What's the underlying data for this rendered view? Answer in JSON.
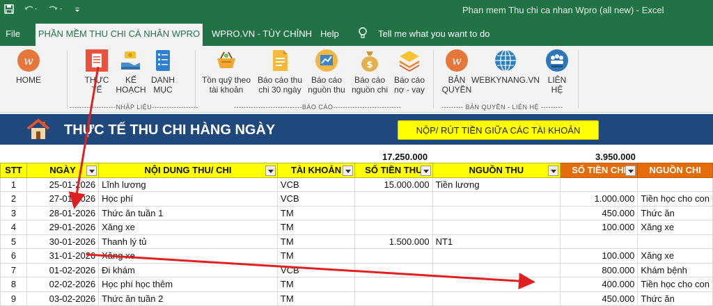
{
  "titlebar": {
    "title": "Phan mem Thu chi ca nhan Wpro (all new)  -  Excel"
  },
  "menu": {
    "file": "File",
    "active_tab": "PHẦN MỀM THU CHI CÁ NHÂN WPRO",
    "tab2": "WPRO.VN - TÙY CHỈNH",
    "help": "Help",
    "tell_me": "Tell me what you want to do"
  },
  "ribbon": {
    "home": "HOME",
    "thuc_te_1": "THỰC",
    "thuc_te_2": "TẾ",
    "ke_hoach_1": "KẾ",
    "ke_hoach_2": "HOẠCH",
    "danh_muc_1": "DANH",
    "danh_muc_2": "MỤC",
    "ton_quy_1": "Tồn quỹ theo",
    "ton_quy_2": "tài khoản",
    "bc30_1": "Báo cáo thu",
    "bc30_2": "chi 30 ngày",
    "bcnt_1": "Báo cáo",
    "bcnt_2": "nguồn thu",
    "bcnc_1": "Báo cáo",
    "bcnc_2": "nguồn chi",
    "bcno_1": "Báo cáo",
    "bcno_2": "nợ - vay",
    "ban_quyen_1": "BẢN",
    "ban_quyen_2": "QUYỀN",
    "webkynang": "WEBKYNANG.VN",
    "lien_he_1": "LIÊN",
    "lien_he_2": "HỆ",
    "group_nhap_lieu": "-------------------NHẬP LIỆU-------------------",
    "group_bao_cao": "----------------------------BÁO CÁO----------------------------",
    "group_ban_quyen": "--------- BẢN QUYỀN - LIÊN HỆ ---------"
  },
  "sheet": {
    "title": "THỰC TẾ THU CHI HÀNG NGÀY",
    "transfer_button": "NỘP/ RÚT TIỀN GIỮA CÁC TÀI KHOẢN",
    "total_thu": "17.250.000",
    "total_chi": "3.950.000",
    "headers": [
      "STT",
      "NGÀY",
      "NỘI DUNG THU/ CHI",
      "TÀI KHOẢN",
      "SỐ TIỀN THU",
      "NGUỒN THU",
      "SỐ TIỀN CHI",
      "NGUỒN CHI"
    ],
    "rows": [
      {
        "stt": "1",
        "date": "25-01-2026",
        "desc": "Lĩnh lương",
        "acct": "VCB",
        "thu": "15.000.000",
        "src_thu": "Tiền lương",
        "chi": "",
        "src_chi": ""
      },
      {
        "stt": "2",
        "date": "27-01-2026",
        "desc": "Học phí",
        "acct": "VCB",
        "thu": "",
        "src_thu": "",
        "chi": "1.000.000",
        "src_chi": "Tiền học cho con"
      },
      {
        "stt": "3",
        "date": "28-01-2026",
        "desc": "Thức ăn tuần 1",
        "acct": "TM",
        "thu": "",
        "src_thu": "",
        "chi": "450.000",
        "src_chi": "Thức ăn"
      },
      {
        "stt": "4",
        "date": "29-01-2026",
        "desc": "Xăng xe",
        "acct": "TM",
        "thu": "",
        "src_thu": "",
        "chi": "100.000",
        "src_chi": "Xăng xe"
      },
      {
        "stt": "5",
        "date": "30-01-2026",
        "desc": "Thanh lý tủ",
        "acct": "TM",
        "thu": "1.500.000",
        "src_thu": "NT1",
        "chi": "",
        "src_chi": ""
      },
      {
        "stt": "6",
        "date": "31-01-2026",
        "desc": "Xăng xe",
        "acct": "TM",
        "thu": "",
        "src_thu": "",
        "chi": "100.000",
        "src_chi": "Xăng xe"
      },
      {
        "stt": "7",
        "date": "01-02-2026",
        "desc": "Đi khám",
        "acct": "VCB",
        "thu": "",
        "src_thu": "",
        "chi": "800.000",
        "src_chi": "Khám bệnh"
      },
      {
        "stt": "8",
        "date": "02-02-2026",
        "desc": "Học phí học thêm",
        "acct": "TM",
        "thu": "",
        "src_thu": "",
        "chi": "400.000",
        "src_chi": "Tiền học cho con"
      },
      {
        "stt": "9",
        "date": "03-02-2026",
        "desc": "Thức ăn tuần 2",
        "acct": "TM",
        "thu": "",
        "src_thu": "",
        "chi": "450.000",
        "src_chi": "Thức ăn"
      }
    ]
  }
}
